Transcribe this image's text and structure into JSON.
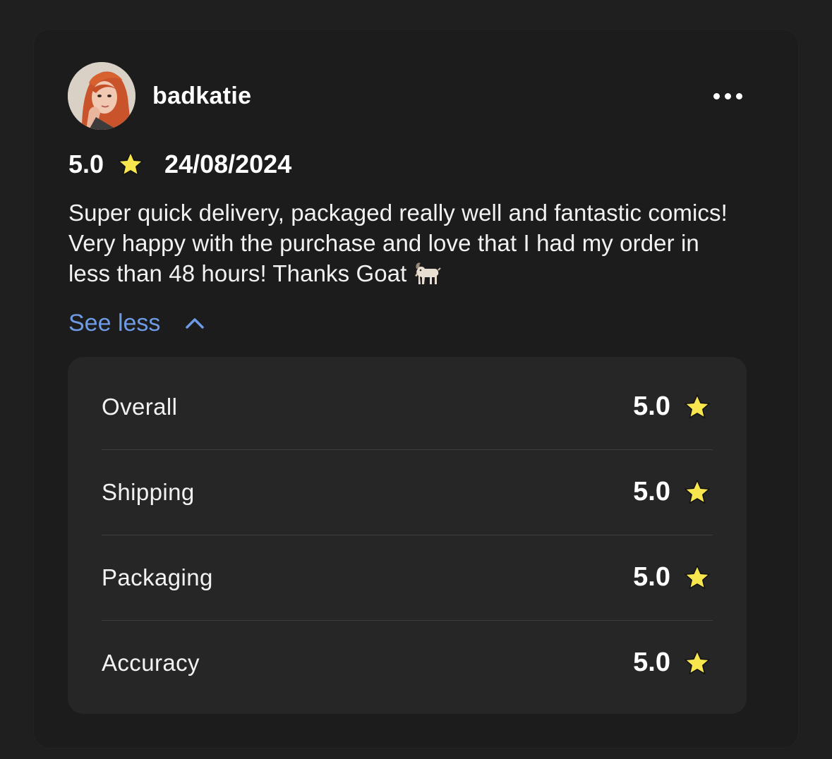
{
  "review": {
    "username": "badkatie",
    "rating": "5.0",
    "date": "24/08/2024",
    "text": "Super quick delivery, packaged really well and fantastic comics! Very happy with the purchase and love that I had my order in less than 48 hours! Thanks Goat",
    "text_emoji_icon": "goat-icon",
    "toggle_label": "See less",
    "more_icon": "ellipsis-icon"
  },
  "breakdown": [
    {
      "label": "Overall",
      "value": "5.0"
    },
    {
      "label": "Shipping",
      "value": "5.0"
    },
    {
      "label": "Packaging",
      "value": "5.0"
    },
    {
      "label": "Accuracy",
      "value": "5.0"
    }
  ],
  "colors": {
    "background": "#1f1f1f",
    "card": "#1c1c1c",
    "panel": "#262626",
    "link": "#6d9be6",
    "star": "#f7e64d",
    "text": "#ffffff"
  }
}
